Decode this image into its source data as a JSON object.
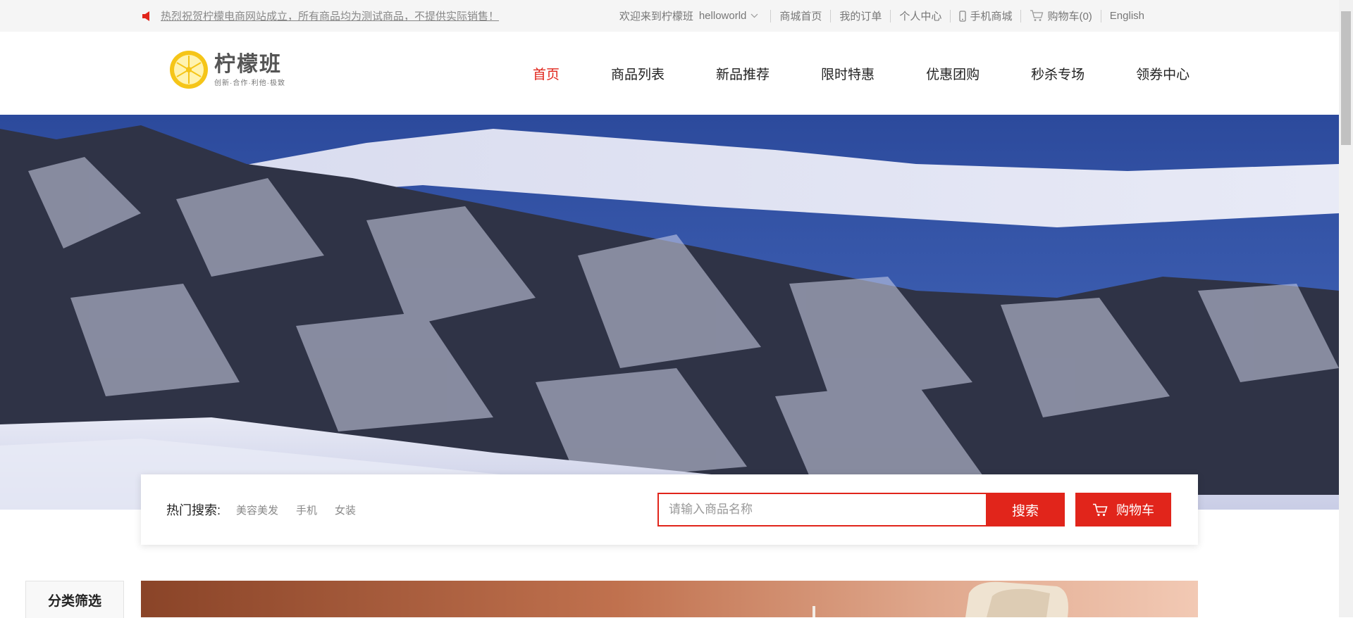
{
  "topbar": {
    "notice": "热烈祝贺柠檬电商网站成立，所有商品均为测试商品，不提供实际销售！",
    "welcome": "欢迎来到柠檬班",
    "username": "helloworld",
    "links": {
      "home": "商城首页",
      "orders": "我的订单",
      "profile": "个人中心",
      "mobile": "手机商城",
      "cart": "购物车(0)",
      "english": "English"
    }
  },
  "logo": {
    "name": "柠檬班",
    "slogan": "创新·合作·利他·极致"
  },
  "nav": [
    "首页",
    "商品列表",
    "新品推荐",
    "限时特惠",
    "优惠团购",
    "秒杀专场",
    "领券中心"
  ],
  "search": {
    "hot_label": "热门搜索:",
    "hot_keywords": [
      "美容美发",
      "手机",
      "女装"
    ],
    "placeholder": "请输入商品名称",
    "button": "搜索",
    "cart_button": "购物车"
  },
  "category_filter": "分类筛选",
  "colors": {
    "accent": "#e1251b",
    "topbar_bg": "#f5f5f5",
    "logo_yellow": "#f5c518"
  }
}
